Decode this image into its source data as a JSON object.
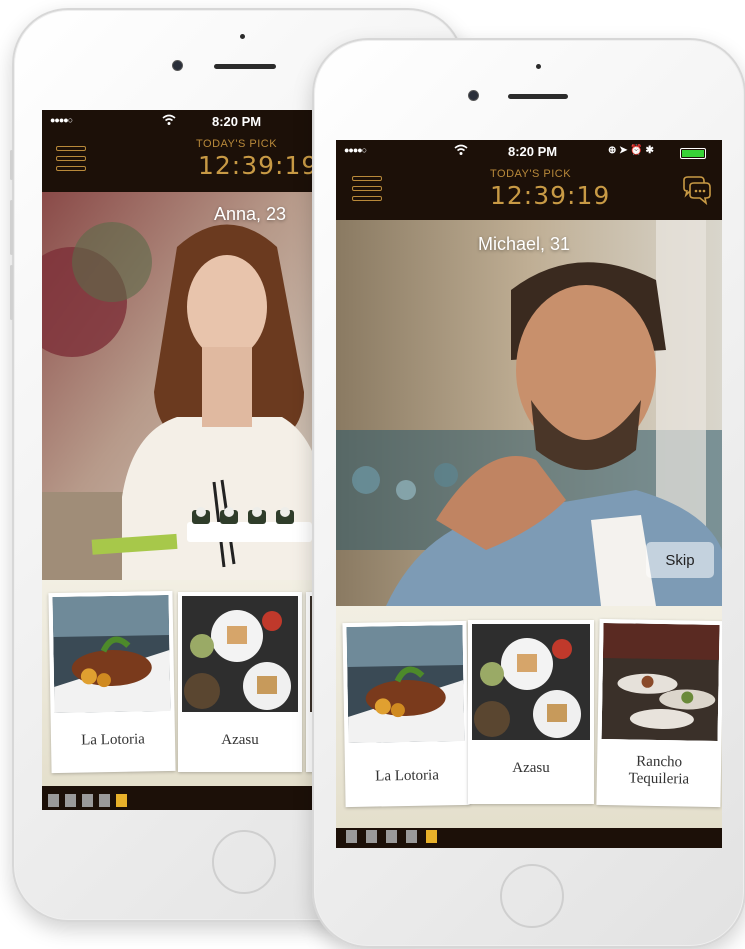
{
  "status_bar": {
    "signal": "●●●●○",
    "wifi": "wifi-icon",
    "time": "8:20 PM",
    "icons": "⊕ ➤ ⏰ ✱"
  },
  "header": {
    "menu_icon": "hamburger-menu-icon",
    "todays_pick_label": "TODAY'S PICK",
    "countdown": "12:39:19",
    "chat_icon": "chat-bubbles-icon"
  },
  "screens": {
    "back": {
      "profile_name": "Anna, 23",
      "venues": [
        "La Lotoria",
        "Azasu"
      ],
      "pager_count": 5,
      "pager_active": 4
    },
    "front": {
      "profile_name": "Michael, 31",
      "skip_label": "Skip",
      "venues": [
        "La Lotoria",
        "Azasu",
        "Rancho Tequileria"
      ],
      "pager_count": 5,
      "pager_active": 4
    }
  },
  "colors": {
    "accent_gold": "#c89a45",
    "bar_brown": "#1c1008",
    "pager_active": "#e8b12a",
    "pager_inactive": "#9a9a9a"
  }
}
